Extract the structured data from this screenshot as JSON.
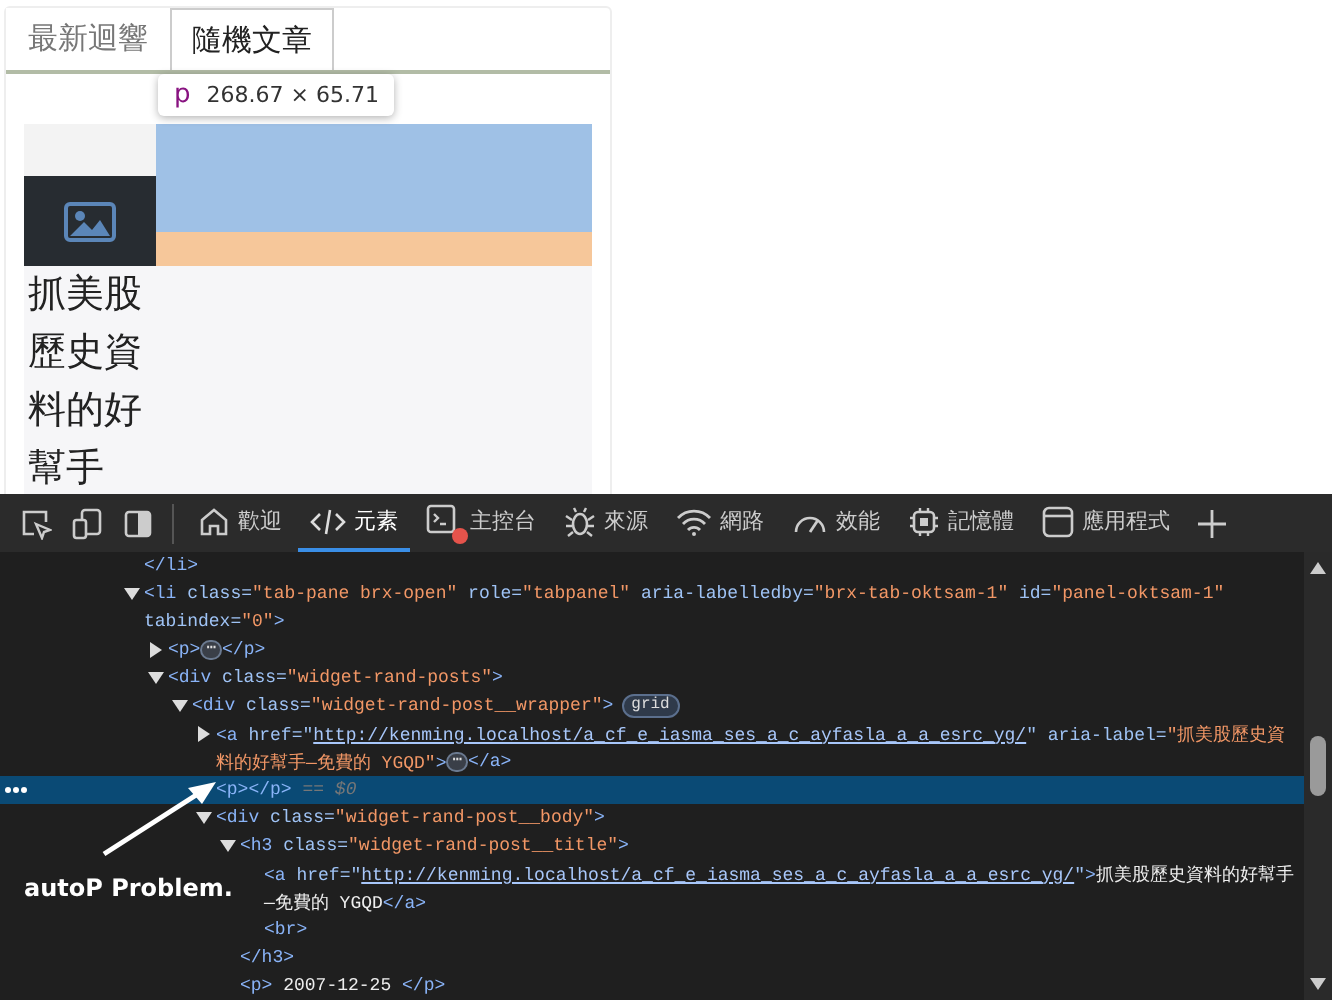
{
  "page": {
    "tabs": [
      {
        "label": "最新迴響",
        "selected": false
      },
      {
        "label": "隨機文章",
        "selected": true
      }
    ],
    "inspect_tooltip": {
      "tag": "p",
      "size": "268.67 × 65.71"
    },
    "post": {
      "title": "抓美股歷史資料的好幫手"
    }
  },
  "devtools": {
    "tabs": [
      {
        "label": "歡迎",
        "selected": false,
        "has_errors": false
      },
      {
        "label": "元素",
        "selected": true,
        "has_errors": false
      },
      {
        "label": "主控台",
        "selected": false,
        "has_errors": true
      },
      {
        "label": "來源",
        "selected": false,
        "has_errors": false
      },
      {
        "label": "網路",
        "selected": false,
        "has_errors": false
      },
      {
        "label": "效能",
        "selected": false,
        "has_errors": false
      },
      {
        "label": "記憶體",
        "selected": false,
        "has_errors": false
      },
      {
        "label": "應用程式",
        "selected": false,
        "has_errors": false
      }
    ],
    "dom_tree": [
      {
        "selected": false,
        "lines": [
          [
            {
              "kind": "tag",
              "text": "</li>"
            }
          ]
        ]
      },
      {
        "selected": false,
        "expanded": true,
        "lines": [
          [
            {
              "kind": "tag",
              "text": "<li"
            },
            {
              "kind": "attr",
              "text": " class="
            },
            {
              "kind": "value",
              "text": "\"tab-pane brx-open\""
            },
            {
              "kind": "attr",
              "text": " role="
            },
            {
              "kind": "value",
              "text": "\"tabpanel\""
            },
            {
              "kind": "attr",
              "text": " aria-labelledby="
            },
            {
              "kind": "value",
              "text": "\"brx-tab-oktsam-1\""
            },
            {
              "kind": "attr",
              "text": " id="
            },
            {
              "kind": "value",
              "text": "\"panel-oktsam-1\""
            }
          ],
          [
            {
              "kind": "attr",
              "text": "tabindex="
            },
            {
              "kind": "value",
              "text": "\"0\""
            },
            {
              "kind": "tag",
              "text": ">"
            }
          ]
        ],
        "children": [
          {
            "selected": false,
            "expanded": false,
            "lines": [
              [
                {
                  "kind": "tag",
                  "text": "<p>"
                },
                {
                  "kind": "ellipsis",
                  "text": "⋯"
                },
                {
                  "kind": "tag",
                  "text": "</p>"
                }
              ]
            ]
          },
          {
            "selected": false,
            "expanded": true,
            "lines": [
              [
                {
                  "kind": "tag",
                  "text": "<div"
                },
                {
                  "kind": "attr",
                  "text": " class="
                },
                {
                  "kind": "value",
                  "text": "\"widget-rand-posts\""
                },
                {
                  "kind": "tag",
                  "text": ">"
                }
              ]
            ],
            "children": [
              {
                "selected": false,
                "expanded": true,
                "lines": [
                  [
                    {
                      "kind": "tag",
                      "text": "<div"
                    },
                    {
                      "kind": "attr",
                      "text": " class="
                    },
                    {
                      "kind": "value",
                      "text": "\"widget-rand-post__wrapper\""
                    },
                    {
                      "kind": "tag",
                      "text": ">"
                    },
                    {
                      "kind": "badge",
                      "text": "grid"
                    }
                  ]
                ],
                "children": [
                  {
                    "selected": false,
                    "expanded": false,
                    "lines": [
                      [
                        {
                          "kind": "tag",
                          "text": "<a"
                        },
                        {
                          "kind": "attr",
                          "text": " href="
                        },
                        {
                          "kind": "attr",
                          "text": "\""
                        },
                        {
                          "kind": "link",
                          "text": "http://kenming.localhost/a_cf_e_iasma_ses_a_c_ayfasla_a_a_esrc_yg/"
                        },
                        {
                          "kind": "attr",
                          "text": "\""
                        },
                        {
                          "kind": "attr",
                          "text": " aria-label="
                        },
                        {
                          "kind": "value",
                          "text": "\"抓美股歷史資"
                        }
                      ],
                      [
                        {
                          "kind": "value",
                          "text": "料的好幫手—免費的 YGQD\""
                        },
                        {
                          "kind": "tag",
                          "text": ">"
                        },
                        {
                          "kind": "ellipsis",
                          "text": "⋯"
                        },
                        {
                          "kind": "tag",
                          "text": "</a>"
                        }
                      ]
                    ]
                  },
                  {
                    "selected": true,
                    "lines": [
                      [
                        {
                          "kind": "tag",
                          "text": "<p></p>"
                        },
                        {
                          "kind": "comment",
                          "text": " == $0"
                        }
                      ]
                    ]
                  },
                  {
                    "selected": false,
                    "expanded": true,
                    "lines": [
                      [
                        {
                          "kind": "tag",
                          "text": "<div"
                        },
                        {
                          "kind": "attr",
                          "text": " class="
                        },
                        {
                          "kind": "value",
                          "text": "\"widget-rand-post__body\""
                        },
                        {
                          "kind": "tag",
                          "text": ">"
                        }
                      ]
                    ],
                    "children": [
                      {
                        "selected": false,
                        "expanded": true,
                        "lines": [
                          [
                            {
                              "kind": "tag",
                              "text": "<h3"
                            },
                            {
                              "kind": "attr",
                              "text": " class="
                            },
                            {
                              "kind": "value",
                              "text": "\"widget-rand-post__title\""
                            },
                            {
                              "kind": "tag",
                              "text": ">"
                            }
                          ]
                        ],
                        "children": [
                          {
                            "selected": false,
                            "lines": [
                              [
                                {
                                  "kind": "tag",
                                  "text": "<a"
                                },
                                {
                                  "kind": "attr",
                                  "text": " href="
                                },
                                {
                                  "kind": "attr",
                                  "text": "\""
                                },
                                {
                                  "kind": "link",
                                  "text": "http://kenming.localhost/a_cf_e_iasma_ses_a_c_ayfasla_a_a_esrc_yg/"
                                },
                                {
                                  "kind": "attr",
                                  "text": "\""
                                },
                                {
                                  "kind": "tag",
                                  "text": ">"
                                },
                                {
                                  "kind": "text",
                                  "text": "抓美股歷史資料的好幫手"
                                }
                              ],
                              [
                                {
                                  "kind": "text",
                                  "text": "—免費的 YGQD"
                                },
                                {
                                  "kind": "tag",
                                  "text": "</a>"
                                }
                              ]
                            ]
                          },
                          {
                            "selected": false,
                            "lines": [
                              [
                                {
                                  "kind": "tag",
                                  "text": "<br>"
                                }
                              ]
                            ]
                          }
                        ]
                      },
                      {
                        "selected": false,
                        "lines": [
                          [
                            {
                              "kind": "tag",
                              "text": "</h3>"
                            }
                          ]
                        ]
                      },
                      {
                        "selected": false,
                        "lines": [
                          [
                            {
                              "kind": "tag",
                              "text": "<p>"
                            },
                            {
                              "kind": "text",
                              "text": " 2007-12-25 "
                            },
                            {
                              "kind": "tag",
                              "text": "</p>"
                            }
                          ]
                        ]
                      }
                    ]
                  }
                ]
              }
            ]
          }
        ]
      }
    ]
  },
  "annotation": {
    "text": "autoP Problem."
  }
}
